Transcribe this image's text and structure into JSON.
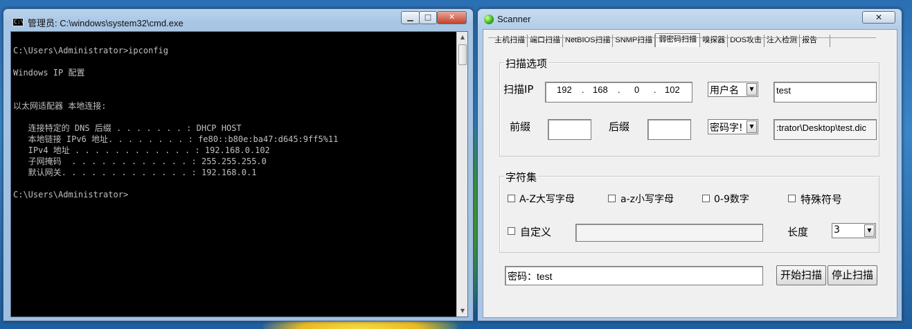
{
  "cmd": {
    "title": "管理员: C:\\windows\\system32\\cmd.exe",
    "icon_label": "C:\\",
    "controls": {
      "minimize": "▁",
      "maximize": "□",
      "close": "✕"
    },
    "lines": [
      "",
      "C:\\Users\\Administrator>ipconfig",
      "",
      "Windows IP 配置",
      "",
      "",
      "以太网适配器 本地连接:",
      "",
      "   连接特定的 DNS 后缀 . . . . . . . : DHCP HOST",
      "   本地链接 IPv6 地址. . . . . . . . : fe80::b80e:ba47:d645:9ff5%11",
      "   IPv4 地址 . . . . . . . . . . . . : 192.168.0.102",
      "   子网掩码  . . . . . . . . . . . . : 255.255.255.0",
      "   默认网关. . . . . . . . . . . . . : 192.168.0.1",
      "",
      "C:\\Users\\Administrator>"
    ]
  },
  "scanner": {
    "title": "Scanner",
    "close_label": "✕",
    "tabs": [
      "主机扫描",
      "端口扫描",
      "NetBIOS扫描",
      "SNMP扫描",
      "弱密码扫描",
      "嗅探器",
      "DOS攻击",
      "注入检测",
      "报告"
    ],
    "active_tab": "弱密码扫描",
    "scan_options": {
      "group_label": "扫描选项",
      "ip_label": "扫描IP",
      "ip": [
        "192",
        "168",
        "0",
        "102"
      ],
      "ip_dot": ".",
      "user_combo": "用户名",
      "user_value": "test",
      "prefix_label": "前缀",
      "prefix_value": "",
      "suffix_label": "后缀",
      "suffix_value": "",
      "pwd_combo": "密码字!",
      "dict_path": ":trator\\Desktop\\test.dic"
    },
    "charset": {
      "group_label": "字符集",
      "upper": "A-Z大写字母",
      "lower": "a-z小写字母",
      "digits": "0-9数字",
      "special": "特殊符号",
      "custom": "自定义",
      "custom_value": "",
      "length_label": "长度",
      "length_value": "3"
    },
    "result": "密码：test",
    "start_button": "开始扫描",
    "stop_button": "停止扫描"
  }
}
